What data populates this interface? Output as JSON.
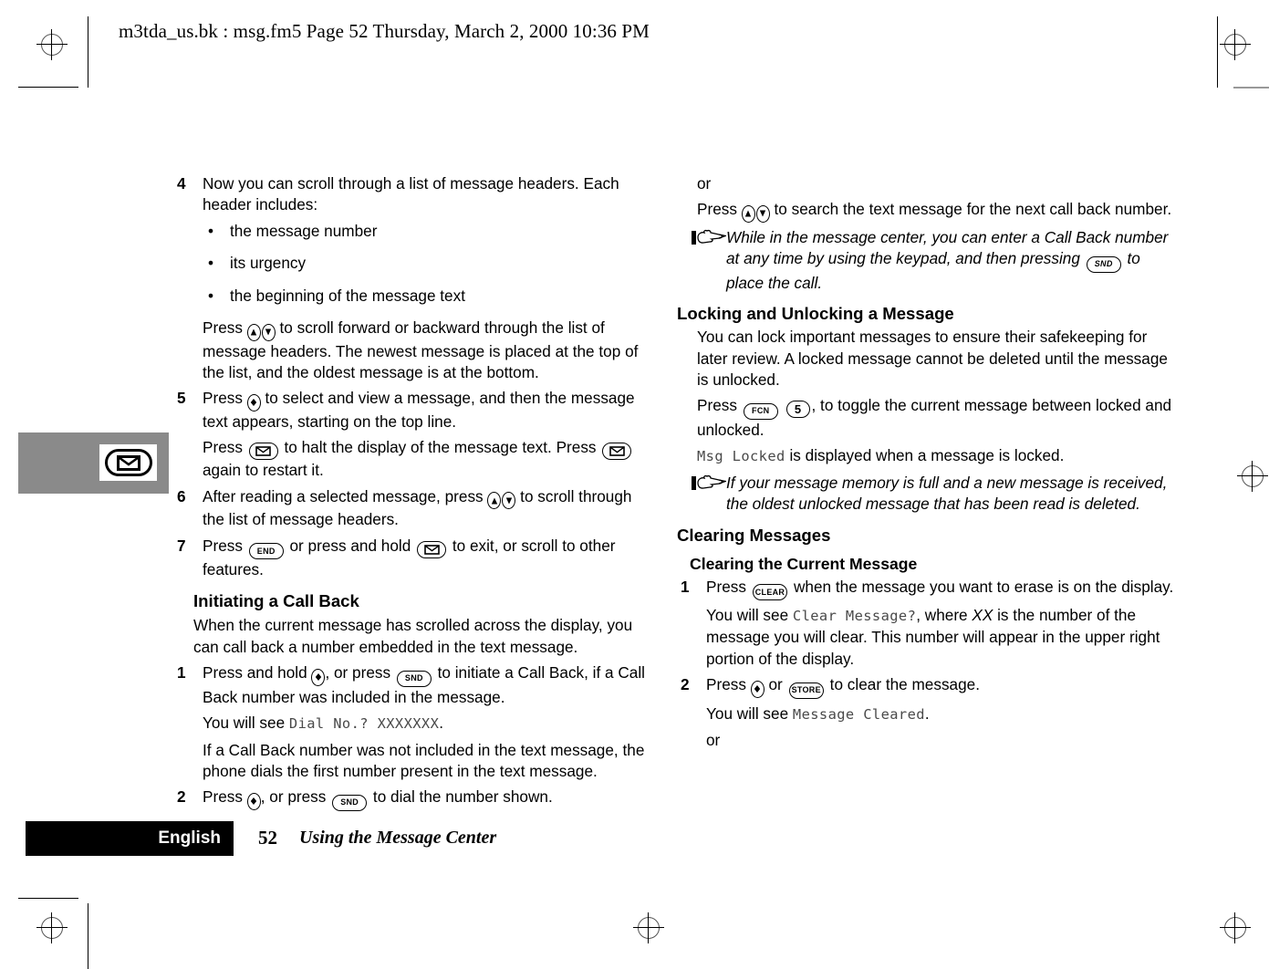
{
  "header": {
    "text": "m3tda_us.bk : msg.fm5  Page 52  Thursday, March 2, 2000  10:36 PM"
  },
  "side_tab": {
    "icon": "envelope-key-icon"
  },
  "left_column": {
    "step4": {
      "number": "4",
      "text": "Now you can scroll through a list of message headers. Each header includes:"
    },
    "bullets": [
      {
        "marker": "•",
        "text": "the message number"
      },
      {
        "marker": "•",
        "text": "its urgency"
      },
      {
        "marker": "•",
        "text": "the beginning of the message text"
      }
    ],
    "scroll_para": {
      "before": "Press ",
      "after": " to scroll forward or backward through the list of message headers. The newest message is placed at the top of the list, and the oldest message is at the bottom."
    },
    "step5": {
      "number": "5",
      "before": "Press ",
      "after": " to select and view a message, and then the message text appears, starting on the top line."
    },
    "step5_cont": {
      "part1": "Press ",
      "part2": " to halt the display of the message text. Press ",
      "part3": " again to restart it."
    },
    "step6": {
      "number": "6",
      "before": "After reading a selected message, press ",
      "after": " to scroll through the list of message headers."
    },
    "step7": {
      "number": "7",
      "part1": "Press ",
      "part2": " or press and hold ",
      "part3": " to exit, or scroll to other features."
    },
    "heading_callback": "Initiating a Call Back",
    "callback_intro": "When the current message has scrolled across the display, you can call back a number embedded in the text message.",
    "cb_step1": {
      "number": "1",
      "part1": "Press and hold ",
      "part2": ", or press ",
      "part3": " to initiate a Call Back, if a Call Back number was included in the message."
    },
    "cb_step1_display": {
      "before": "You will see ",
      "lcd": "Dial No.? XXXXXXX",
      "after": "."
    },
    "cb_note": "If a Call Back number was not included in the text message, the phone dials the first number present in the text message.",
    "cb_step2": {
      "number": "2",
      "part1": "Press ",
      "part2": ", or press ",
      "part3": " to dial the number shown."
    }
  },
  "right_column": {
    "or_1": "or",
    "search_para": {
      "before": "Press ",
      "after": " to search the text message for the next call back number."
    },
    "note_1": {
      "part1": "While in the message center, you can enter a Call Back number at any time by using the keypad, and then pressing ",
      "part2": " to place the call."
    },
    "heading_locking": "Locking and Unlocking a Message",
    "locking_intro": "You can lock important messages to ensure their safekeeping for later review. A locked message cannot be deleted until the message is unlocked.",
    "locking_press": {
      "before": "Press ",
      "middle": " ",
      "after": ", to toggle the current message between locked and unlocked."
    },
    "msg_locked": {
      "lcd": "Msg Locked",
      "after": " is displayed when a message is locked."
    },
    "note_2": "If your message memory is full and a new message is received, the oldest unlocked message that has been read is deleted.",
    "heading_clearing": "Clearing Messages",
    "heading_clearing_current": "Clearing the Current Message",
    "cl_step1": {
      "number": "1",
      "part1": "Press ",
      "part2": " when the message you want to erase is on the display."
    },
    "cl_step1_display": {
      "before": "You will see ",
      "lcd": "Clear Message?",
      "middle": ", where ",
      "italic": "XX",
      "after": " is the number of the message you will clear. This number will appear in the upper right portion of the display."
    },
    "cl_step2": {
      "number": "2",
      "part1": "Press ",
      "part2": " or ",
      "part3": " to clear the message."
    },
    "cl_step2_display": {
      "before": "You will see ",
      "lcd": "Message Cleared",
      "after": "."
    },
    "or_2": "or"
  },
  "keys": {
    "snd": "SND",
    "end": "END",
    "fcn": "FCN",
    "clear": "CLEAR",
    "store": "STORE",
    "five": "5",
    "envelope": "envelope-key-icon",
    "nav_up": "nav-up-key-icon",
    "nav_down": "nav-down-key-icon"
  },
  "footer": {
    "language": "English",
    "page_number": "52",
    "section_title": "Using the Message Center"
  }
}
